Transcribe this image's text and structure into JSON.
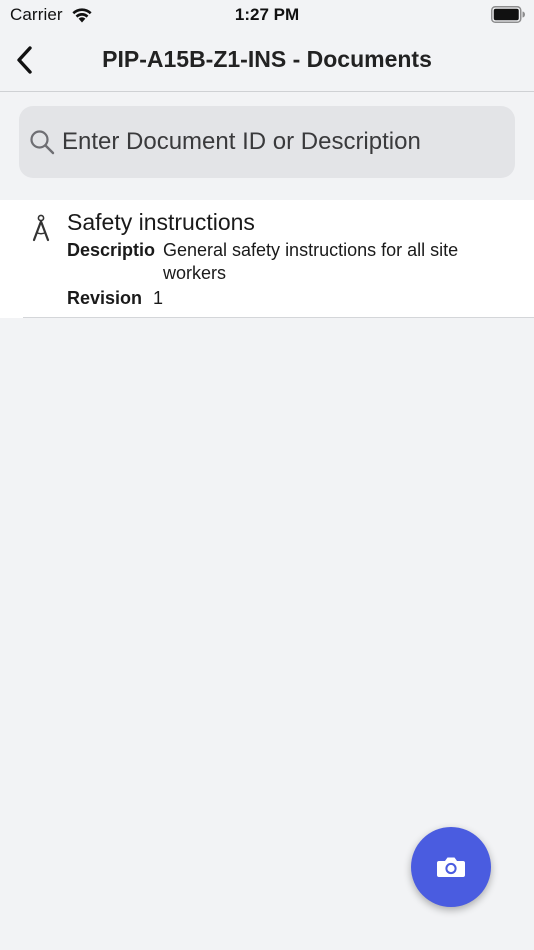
{
  "status_bar": {
    "carrier": "Carrier",
    "time": "1:27 PM",
    "wifi_icon": "wifi-icon",
    "battery_icon": "battery-icon"
  },
  "nav": {
    "back_icon": "chevron-left-icon",
    "title": "PIP-A15B-Z1-INS - Documents"
  },
  "search": {
    "icon": "search-icon",
    "placeholder": "Enter Document ID or Description",
    "value": ""
  },
  "documents": [
    {
      "icon": "compass-drafting-icon",
      "title": "Safety instructions",
      "description_label": "Description",
      "description": "General safety instructions for all site workers",
      "revision_label": "Revision",
      "revision": "1"
    }
  ],
  "fab": {
    "icon": "camera-icon"
  },
  "colors": {
    "background": "#f2f3f5",
    "row_background": "#ffffff",
    "search_background": "#e3e4e7",
    "fab": "#4a5ce0"
  }
}
